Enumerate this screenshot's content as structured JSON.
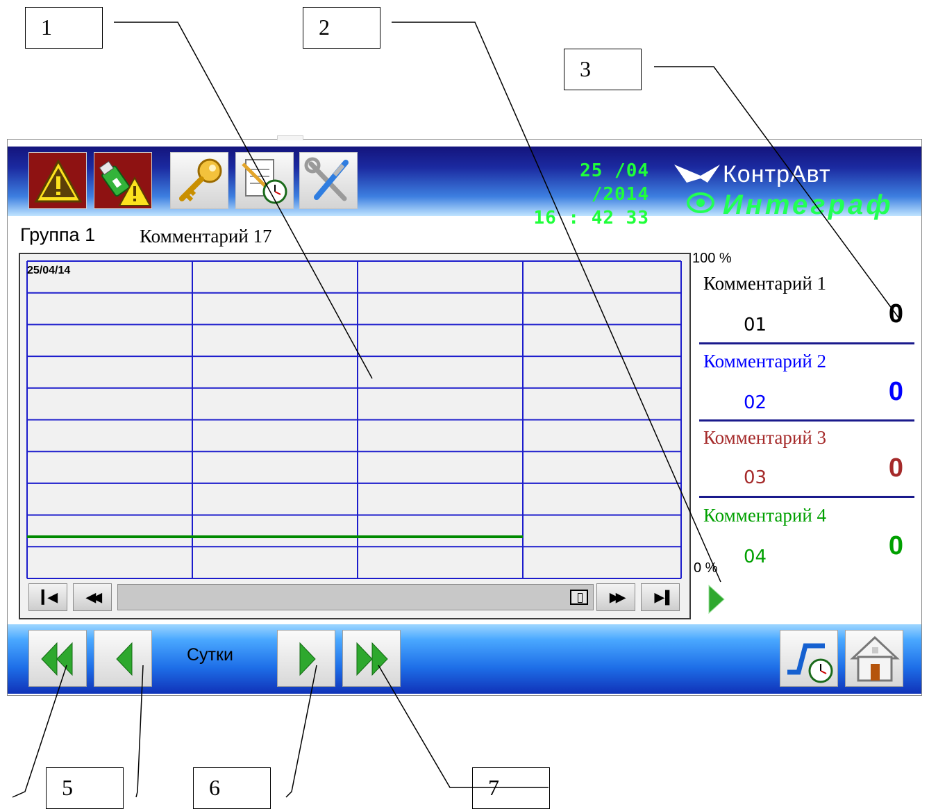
{
  "callouts": [
    "1",
    "2",
    "3",
    "5",
    "6",
    "7"
  ],
  "header": {
    "date": "25 /04 /2014",
    "time": "16 : 42   33",
    "brand": "КонтрАвт",
    "product": "Интеграф",
    "toolbar_icons": [
      "alarm-warning-icon",
      "usb-warning-icon",
      "key-icon",
      "log-clock-icon",
      "tools-icon"
    ]
  },
  "group": {
    "title": "Группа 1",
    "comment": "Комментарий 17"
  },
  "chart": {
    "date_label": "25/04/14",
    "scale_max": "100 %",
    "scale_min": "0 %"
  },
  "channels": [
    {
      "label": "Комментарий 1",
      "code": "01",
      "value": "0",
      "color": "#000000"
    },
    {
      "label": "Комментарий 2",
      "code": "02",
      "value": "0",
      "color": "#0000ff"
    },
    {
      "label": "Комментарий 3",
      "code": "03",
      "value": "0",
      "color": "#a52a2a"
    },
    {
      "label": "Комментарий 4",
      "code": "04",
      "value": "0",
      "color": "#00a000"
    }
  ],
  "footer": {
    "period": "Сутки",
    "nav_icons": [
      "double-left-icon",
      "left-icon",
      "right-icon",
      "double-right-icon"
    ],
    "right_icons": [
      "trend-clock-icon",
      "home-icon"
    ]
  },
  "colors": {
    "grid": "#1c1ccc",
    "trace": "#008a00",
    "clock": "#1fff3a"
  }
}
